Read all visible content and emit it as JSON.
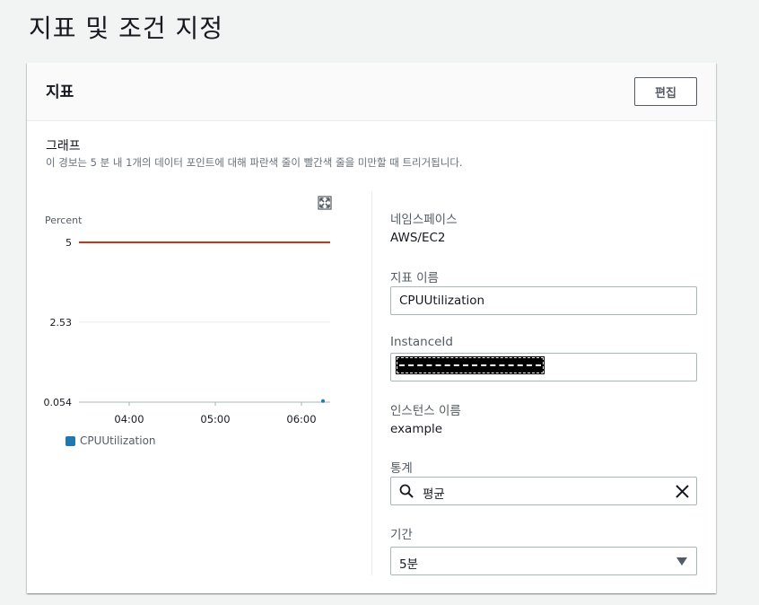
{
  "page": {
    "title": "지표 및 조건 지정"
  },
  "panel": {
    "title": "지표",
    "edit_label": "편집"
  },
  "graph": {
    "label": "그래프",
    "description": "이 경보는 5 분 내 1개의 데이터 포인트에 대해 파란색 줄이 빨간색 줄을 미만할 때 트리거됩니다.",
    "expand_icon": "expand-icon"
  },
  "chart_data": {
    "type": "line",
    "ylabel": "Percent",
    "y_ticks": [
      "5",
      "2.53",
      "0.054"
    ],
    "y_tick_values": [
      5,
      2.53,
      0.054
    ],
    "ylim": [
      0.054,
      5
    ],
    "x_ticks": [
      "04:00",
      "05:00",
      "06:00"
    ],
    "threshold": {
      "value": 5,
      "color": "#d13212"
    },
    "series": [
      {
        "name": "CPUUtilization",
        "color": "#1f77b4",
        "points": [
          {
            "x": "06:15",
            "y": 0.06
          }
        ]
      }
    ],
    "grid": true,
    "legend_position": "bottom-left"
  },
  "details": {
    "namespace_label": "네임스페이스",
    "namespace_value": "AWS/EC2",
    "metric_name_label": "지표 이름",
    "metric_name_value": "CPUUtilization",
    "instance_id_label": "InstanceId",
    "instance_name_label": "인스턴스 이름",
    "instance_name_value": "example",
    "statistic_label": "통계",
    "statistic_value": "평균",
    "period_label": "기간",
    "period_value": "5분"
  }
}
